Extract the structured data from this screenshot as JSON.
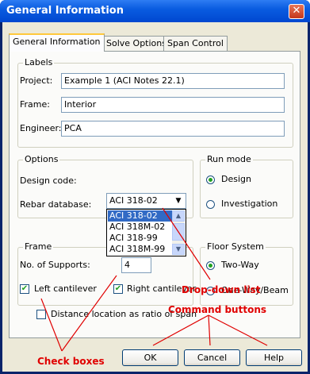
{
  "window": {
    "title": "General Information",
    "close_symbol": "✕"
  },
  "tabs": [
    "General Information",
    "Solve Options",
    "Span Control"
  ],
  "labels_group": {
    "legend": "Labels",
    "project_label": "Project:",
    "project_value": "Example 1 (ACI Notes 22.1)",
    "frame_label": "Frame:",
    "frame_value": "Interior",
    "engineer_label": "Engineer:",
    "engineer_value": "PCA"
  },
  "options_group": {
    "legend": "Options",
    "design_code_label": "Design code:",
    "design_code_value": "ACI 318-02",
    "rebar_label": "Rebar database:",
    "dropdown_options": [
      "ACI 318-02",
      "ACI 318M-02",
      "ACI 318-99",
      "ACI 318M-99"
    ]
  },
  "run_mode": {
    "legend": "Run mode",
    "design": "Design",
    "investigation": "Investigation",
    "selected": "Design"
  },
  "frame_group": {
    "legend": "Frame",
    "supports_label": "No. of Supports:",
    "supports_value": "4",
    "left_cantilever": "Left cantilever",
    "right_cantilever": "Right cantilever",
    "left_checked": true,
    "right_checked": true
  },
  "floor_system": {
    "legend": "Floor System",
    "two_way": "Two-Way",
    "one_way": "One-Way/Beam",
    "selected": "Two-Way"
  },
  "distance_checkbox": "Distance location as ratio of span",
  "buttons": {
    "ok": "OK",
    "cancel": "Cancel",
    "help": "Help"
  },
  "annotations": {
    "dropdown": "Drop-down list",
    "command": "Command buttons",
    "checkboxes": "Check boxes",
    "color": "#e00000"
  }
}
